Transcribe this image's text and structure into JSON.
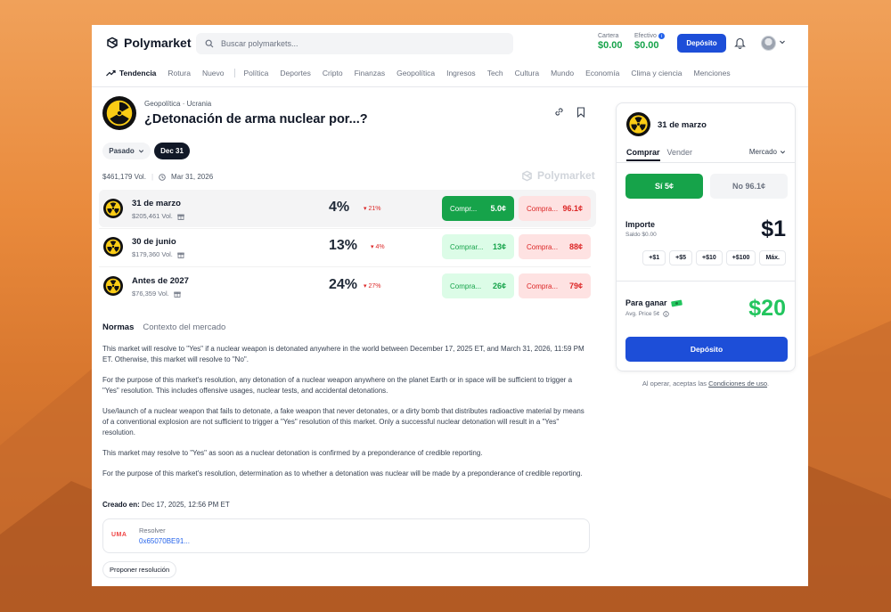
{
  "brand": {
    "name": "Polymarket"
  },
  "search": {
    "placeholder": "Buscar polymarkets..."
  },
  "header": {
    "cartera_label": "Cartera",
    "cartera_value": "$0.00",
    "efectivo_label": "Efectivo",
    "efectivo_value": "$0.00",
    "efectivo_badge": "i",
    "deposit_label": "Depósito"
  },
  "nav": {
    "trending": "Tendencia",
    "items": [
      "Rotura",
      "Nuevo",
      "Política",
      "Deportes",
      "Cripto",
      "Finanzas",
      "Geopolítica",
      "Ingresos",
      "Tech",
      "Cultura",
      "Mundo",
      "Economía",
      "Clima y ciencia",
      "Menciones"
    ]
  },
  "market": {
    "category": "Geopolítica",
    "subcategory": "Ucrania",
    "dot": "·",
    "title": "¿Detonación de arma nuclear por...?",
    "filter_past": "Pasado",
    "filter_date": "Dec 31",
    "volume": "$461,179 Vol.",
    "end_date": "Mar 31, 2026",
    "watermark": "Polymarket"
  },
  "outcomes": [
    {
      "name": "31 de marzo",
      "volume": "$205,461 Vol.",
      "percent": "4%",
      "change": "21%",
      "yes_label": "Compr...",
      "yes_price": "5.0¢",
      "no_label": "Compra...",
      "no_price": "96.1¢"
    },
    {
      "name": "30 de junio",
      "volume": "$179,360 Vol.",
      "percent": "13%",
      "change": "4%",
      "yes_label": "Comprar...",
      "yes_price": "13¢",
      "no_label": "Compra...",
      "no_price": "88¢"
    },
    {
      "name": "Antes de 2027",
      "volume": "$76,359 Vol.",
      "percent": "24%",
      "change": "27%",
      "yes_label": "Compra...",
      "yes_price": "26¢",
      "no_label": "Compra...",
      "no_price": "79¢"
    }
  ],
  "rules": {
    "tab_rules": "Normas",
    "tab_context": "Contexto del mercado",
    "p1": "This market will resolve to \"Yes\" if a nuclear weapon is detonated anywhere in the world between December 17, 2025 ET, and March 31, 2026, 11:59 PM ET. Otherwise, this market will resolve to \"No\".",
    "p2": "For the purpose of this market's resolution, any detonation of a nuclear weapon anywhere on the planet Earth or in space will be sufficient to trigger a \"Yes\" resolution. This includes offensive usages, nuclear tests, and accidental detonations.",
    "p3": "Use/launch of a nuclear weapon that fails to detonate, a fake weapon that never detonates, or a dirty bomb that distributes radioactive material by means of a conventional explosion are not sufficient to trigger a \"Yes\" resolution of this market. Only a successful nuclear detonation will result in a \"Yes\" resolution.",
    "p4": "This market may resolve to \"Yes\" as soon as a nuclear detonation is confirmed by a preponderance of credible reporting.",
    "p5": "For the purpose of this market's resolution, determination as to whether a detonation was nuclear will be made by a preponderance of credible reporting.",
    "created_label": "Creado en:",
    "created_value": "Dec 17, 2025, 12:56 PM ET",
    "uma": "UMA",
    "resolver_label": "Resolver",
    "resolver_address": "0x65070BE91...",
    "propose": "Proponer resolución"
  },
  "panel": {
    "title": "31 de marzo",
    "tab_buy": "Comprar",
    "tab_sell": "Vender",
    "order_type": "Mercado",
    "yes_label": "Sí 5¢",
    "no_label": "No 96.1¢",
    "amount_label": "Importe",
    "balance": "Saldo $0.00",
    "amount": "$1",
    "chips": [
      "+$1",
      "+$5",
      "+$10",
      "+$100",
      "Máx."
    ],
    "win_label": "Para ganar",
    "avg_price": "Avg. Price 5¢",
    "win_amount": "$20",
    "deposit": "Depósito"
  },
  "terms": {
    "prefix": "Al operar, aceptas las",
    "link": "Condiciones de uso",
    "suffix": "."
  },
  "colors": {
    "green": "#16a34a",
    "red": "#dc2626",
    "blue": "#1d4ed8"
  }
}
